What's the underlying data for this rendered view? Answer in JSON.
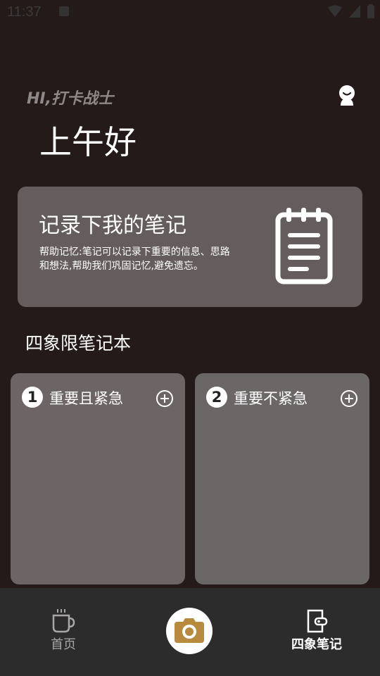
{
  "status_bar": {
    "time": "11:37"
  },
  "header": {
    "greeting_hi": "HI,打卡战士",
    "greeting_main": "上午好"
  },
  "banner": {
    "title": "记录下我的笔记",
    "description": "帮助记忆:笔记可以记录下重要的信息、思路和想法,帮助我们巩固记忆,避免遗忘。"
  },
  "section": {
    "title": "四象限笔记本"
  },
  "quadrants": [
    {
      "number": "1",
      "title": "重要且紧急"
    },
    {
      "number": "2",
      "title": "重要不紧急"
    }
  ],
  "bottom_nav": {
    "home_label": "首页",
    "notes_label": "四象笔记"
  },
  "colors": {
    "background": "#231a19",
    "card": "#655d5d",
    "quadrant_1": "#6d6565",
    "quadrant_2": "#6b6767",
    "nav_bg": "#2d2c2c",
    "camera_accent": "#b88a3e"
  }
}
